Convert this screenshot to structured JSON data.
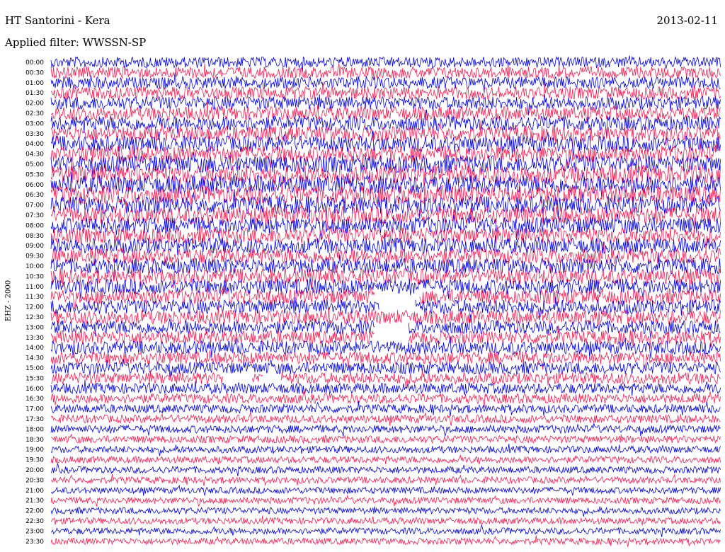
{
  "header": {
    "station": "HT Santorini - Kera",
    "date": "2013-02-11",
    "filter": "Applied filter: WWSSN-SP"
  },
  "chart_data": {
    "type": "helicorder",
    "ylabel": "EHZ - 2000",
    "row_labels": [
      "00:00",
      "00:30",
      "01:00",
      "01:30",
      "02:00",
      "02:30",
      "03:00",
      "03:30",
      "04:00",
      "04:30",
      "05:00",
      "05:30",
      "06:00",
      "06:30",
      "07:00",
      "07:30",
      "08:00",
      "08:30",
      "09:00",
      "09:30",
      "10:00",
      "10:30",
      "11:00",
      "11:30",
      "12:00",
      "12:30",
      "13:00",
      "13:30",
      "14:00",
      "14:30",
      "15:00",
      "15:30",
      "16:00",
      "16:30",
      "17:00",
      "17:30",
      "18:00",
      "18:30",
      "19:00",
      "19:30",
      "20:00",
      "20:30",
      "21:00",
      "21:30",
      "22:00",
      "22:30",
      "23:00",
      "23:30"
    ],
    "colors": [
      "#0000ee",
      "#ff1a4f"
    ],
    "noise_level": [
      0.55,
      0.6,
      0.62,
      0.65,
      0.68,
      0.7,
      0.75,
      0.78,
      0.82,
      0.85,
      0.9,
      0.95,
      0.95,
      0.95,
      0.9,
      0.88,
      0.85,
      0.82,
      0.8,
      0.8,
      0.8,
      0.8,
      0.78,
      0.75,
      0.75,
      0.72,
      0.7,
      0.7,
      0.68,
      0.65,
      0.62,
      0.6,
      0.55,
      0.5,
      0.45,
      0.42,
      0.4,
      0.38,
      0.36,
      0.35,
      0.35,
      0.34,
      0.33,
      0.33,
      0.33,
      0.33,
      0.33,
      0.33
    ],
    "gaps": [
      {
        "row": 23,
        "from_minute": 14.5,
        "to_minute": 16.5
      },
      {
        "row": 24,
        "from_minute": 14.7,
        "to_minute": 16.3
      },
      {
        "row": 26,
        "from_minute": 14.5,
        "to_minute": 16.0
      },
      {
        "row": 27,
        "from_minute": 14.5,
        "to_minute": 16.0
      },
      {
        "row": 31,
        "from_minute": 7.7,
        "to_minute": 9.0
      },
      {
        "row": 31,
        "from_minute": 9.5,
        "to_minute": 10.3
      }
    ]
  }
}
